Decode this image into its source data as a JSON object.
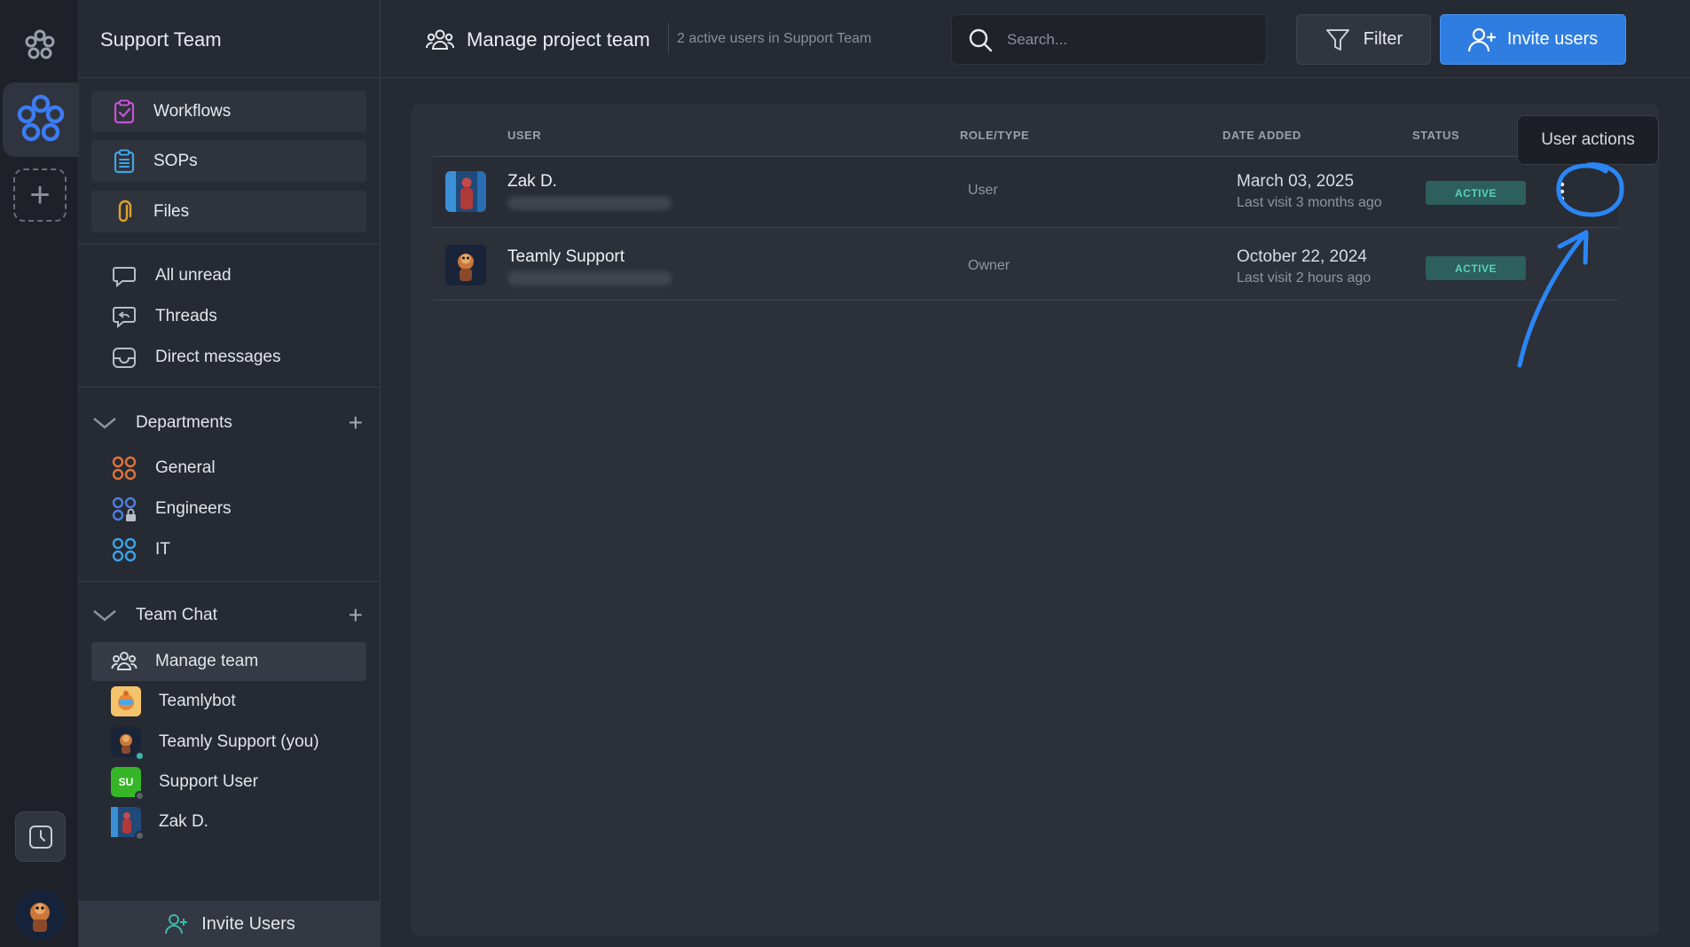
{
  "workspace": {
    "name": "Support Team"
  },
  "sidebar": {
    "cards": [
      {
        "label": "Workflows",
        "icon": "workflow-icon"
      },
      {
        "label": "SOPs",
        "icon": "sop-icon"
      },
      {
        "label": "Files",
        "icon": "paperclip-icon"
      }
    ],
    "nav": [
      {
        "label": "All unread",
        "icon": "chat-bubble-icon"
      },
      {
        "label": "Threads",
        "icon": "threads-icon"
      },
      {
        "label": "Direct messages",
        "icon": "inbox-icon"
      }
    ],
    "departments": {
      "title": "Departments",
      "items": [
        {
          "label": "General",
          "color": "#e0743a"
        },
        {
          "label": "Engineers",
          "color": "#4c7fe0"
        },
        {
          "label": "IT",
          "color": "#3ea2e3"
        }
      ]
    },
    "team_chat": {
      "title": "Team Chat",
      "items": [
        {
          "label": "Manage team"
        },
        {
          "label": "Teamlybot"
        },
        {
          "label": "Teamly Support (you)"
        },
        {
          "label": "Support User",
          "initials": "SU"
        },
        {
          "label": "Zak D."
        }
      ]
    },
    "footer_label": "Invite Users"
  },
  "header": {
    "title": "Manage project team",
    "subtitle": "2 active users in Support Team",
    "search_placeholder": "Search...",
    "filter_label": "Filter",
    "invite_label": "Invite users"
  },
  "table": {
    "columns": [
      "USER",
      "ROLE/TYPE",
      "DATE ADDED",
      "STATUS"
    ],
    "rows": [
      {
        "name": "Zak D.",
        "role": "User",
        "date": "March 03, 2025",
        "last_visit": "Last visit 3 months ago",
        "status": "ACTIVE"
      },
      {
        "name": "Teamly Support",
        "role": "Owner",
        "date": "October 22, 2024",
        "last_visit": "Last visit 2 hours ago",
        "status": "ACTIVE"
      }
    ]
  },
  "tooltip": "User actions",
  "colors": {
    "accent": "#2f7de0",
    "annotation": "#2b86f5",
    "status_bg": "#2d5f5c",
    "status_text": "#59d3b4"
  }
}
